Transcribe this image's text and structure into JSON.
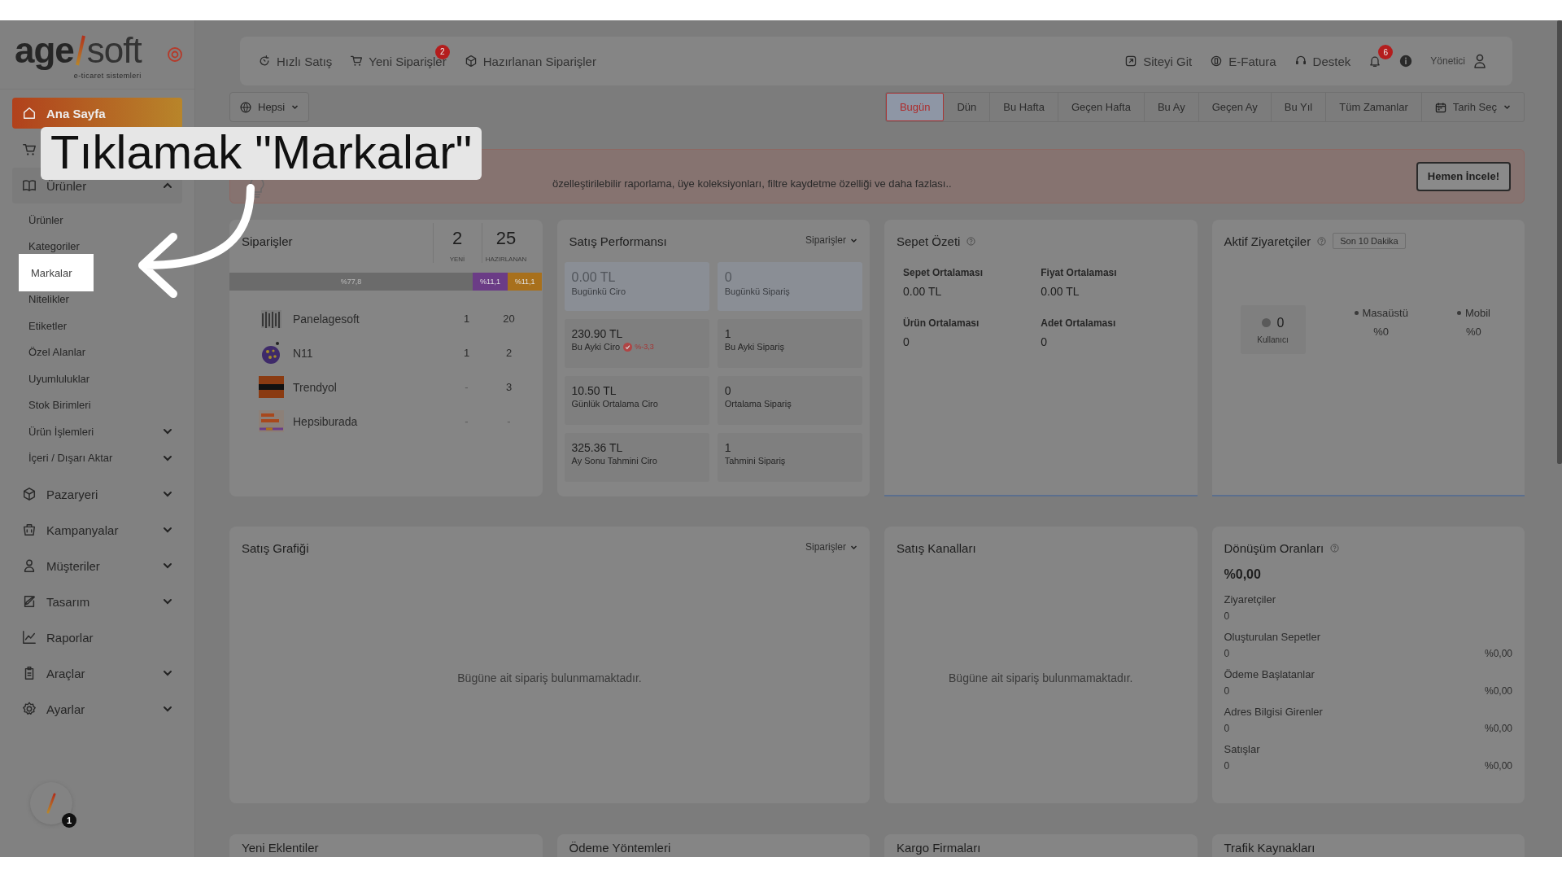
{
  "logo": {
    "part_1": "age",
    "part_2": "soft",
    "tagline": "e-ticaret sistemleri"
  },
  "sidebar": {
    "items": [
      {
        "label": "Ana Sayfa",
        "selected": true
      },
      {
        "selected": false
      },
      {
        "label": "Ürünler",
        "selected": false,
        "expanded": true,
        "children": [
          {
            "label": "Ürünler",
            "spotlight": false
          },
          {
            "label": "Kategoriler",
            "spotlight": false
          },
          {
            "label": "Markalar",
            "spotlight": true
          },
          {
            "label": "Nitelikler",
            "spotlight": false
          },
          {
            "label": "Etiketler",
            "spotlight": false
          },
          {
            "label": "Özel Alanlar",
            "spotlight": false
          },
          {
            "label": "Uyumluluklar",
            "spotlight": false
          },
          {
            "label": "Stok Birimleri",
            "spotlight": false
          },
          {
            "label": "Ürün İşlemleri",
            "spotlight": false,
            "expanded": false
          },
          {
            "label": "İçeri / Dışarı Aktar",
            "spotlight": false,
            "expanded": false
          }
        ]
      },
      {
        "label": "Pazaryeri",
        "selected": false,
        "expanded": false
      },
      {
        "label": "Kampanyalar",
        "selected": false,
        "expanded": false
      },
      {
        "label": "Müşteriler",
        "selected": false,
        "expanded": false
      },
      {
        "label": "Tasarım",
        "selected": false,
        "expanded": false
      },
      {
        "label": "Raporlar",
        "selected": false
      },
      {
        "label": "Araçlar",
        "selected": false,
        "expanded": false
      },
      {
        "label": "Ayarlar",
        "selected": false,
        "expanded": false
      }
    ],
    "launcher_badge": "1"
  },
  "topbar": {
    "left": [
      {
        "label": "Hızlı Satış"
      },
      {
        "label": "Yeni Siparişler",
        "badge": "2"
      },
      {
        "label": "Hazırlanan Siparişler"
      }
    ],
    "right": [
      {
        "label": "Siteyi Git"
      },
      {
        "label": "E-Fatura"
      },
      {
        "label": "Destek"
      }
    ],
    "notifications_badge": "6",
    "user": "Yönetici"
  },
  "filters": {
    "scope": "Hepsi",
    "periods": [
      {
        "label": "Bugün",
        "selected": true
      },
      {
        "label": "Dün",
        "selected": false
      },
      {
        "label": "Bu Hafta",
        "selected": false
      },
      {
        "label": "Geçen Hafta",
        "selected": false
      },
      {
        "label": "Bu Ay",
        "selected": false
      },
      {
        "label": "Geçen Ay",
        "selected": false
      },
      {
        "label": "Bu Yıl",
        "selected": false
      },
      {
        "label": "Tüm Zamanlar",
        "selected": false
      }
    ],
    "date_picker": "Tarih Seç"
  },
  "banner": {
    "text": "özelleştirilebilir raporlama, üye koleksiyonları, filtre kaydetme özelliği ve daha fazlası..",
    "button": "Hemen İncele!"
  },
  "orders": {
    "title": "Siparişler",
    "new_count": "2",
    "new_label": "YENİ",
    "prepared_count": "25",
    "prepared_label": "HAZIRLANAN",
    "segments": [
      {
        "label": "%77,8",
        "color": "#6b6b6b"
      },
      {
        "label": "%11,1",
        "color": "#6b3c86"
      },
      {
        "label": "%11,1",
        "color": "#a8701c"
      }
    ],
    "rows": [
      {
        "name": "Panelagesoft",
        "new": "1",
        "prepared": "20"
      },
      {
        "name": "N11",
        "new": "1",
        "prepared": "2"
      },
      {
        "name": "Trendyol",
        "new": "-",
        "prepared": "3"
      },
      {
        "name": "Hepsiburada",
        "new": "-",
        "prepared": "-"
      }
    ]
  },
  "performance": {
    "title": "Satış Performansı",
    "dropdown": "Siparişler",
    "tiles": [
      {
        "value": "0.00 TL",
        "label": "Bugünkü Ciro",
        "highlighted": true
      },
      {
        "value": "0",
        "label": "Bugünkü Sipariş",
        "highlighted": true
      },
      {
        "value": "230.90 TL",
        "label": "Bu Ayki Ciro",
        "highlighted": false,
        "change": "%-3,3"
      },
      {
        "value": "1",
        "label": "Bu Ayki Sipariş",
        "highlighted": false
      },
      {
        "value": "10.50 TL",
        "label": "Günlük Ortalama Ciro",
        "highlighted": false
      },
      {
        "value": "0",
        "label": "Ortalama Sipariş",
        "highlighted": false
      },
      {
        "value": "325.36 TL",
        "label": "Ay Sonu Tahmini Ciro",
        "highlighted": false
      },
      {
        "value": "1",
        "label": "Tahmini Sipariş",
        "highlighted": false
      }
    ]
  },
  "cart_summary": {
    "title": "Sepet Özeti",
    "stats": [
      {
        "label": "Sepet Ortalaması",
        "value": "0.00 TL"
      },
      {
        "label": "Fiyat Ortalaması",
        "value": "0.00 TL"
      },
      {
        "label": "Ürün Ortalaması",
        "value": "0"
      },
      {
        "label": "Adet Ortalaması",
        "value": "0"
      }
    ]
  },
  "visitors": {
    "title": "Aktif Ziyaretçiler",
    "range": "Son 10 Dakika",
    "count": "0",
    "count_label": "Kullanıcı",
    "devices": [
      {
        "label": "Masaüstü",
        "value": "%0"
      },
      {
        "label": "Mobil",
        "value": "%0"
      }
    ]
  },
  "sales_chart": {
    "title": "Satış Grafiği",
    "dropdown": "Siparişler",
    "empty": "Bügüne ait sipariş bulunmamaktadır."
  },
  "sales_channels": {
    "title": "Satış Kanalları",
    "empty": "Bügüne ait sipariş bulunmamaktadır."
  },
  "conversion": {
    "title": "Dönüşüm Oranları",
    "total": "%0,00",
    "steps": [
      {
        "label": "Ziyaretçiler",
        "value": "0"
      },
      {
        "label": "Oluşturulan Sepetler",
        "value": "0",
        "rate": "%0,00"
      },
      {
        "label": "Ödeme Başlatanlar",
        "value": "0",
        "rate": "%0,00"
      },
      {
        "label": "Adres Bilgisi Girenler",
        "value": "0",
        "rate": "%0,00"
      },
      {
        "label": "Satışlar",
        "value": "0",
        "rate": "%0,00"
      }
    ]
  },
  "bottom_cards": [
    "Yeni Eklentiler",
    "Ödeme Yöntemleri",
    "Kargo Firmaları",
    "Trafik Kaynakları"
  ],
  "tutorial": {
    "callout": "Tıklamak \"Markalar\""
  }
}
